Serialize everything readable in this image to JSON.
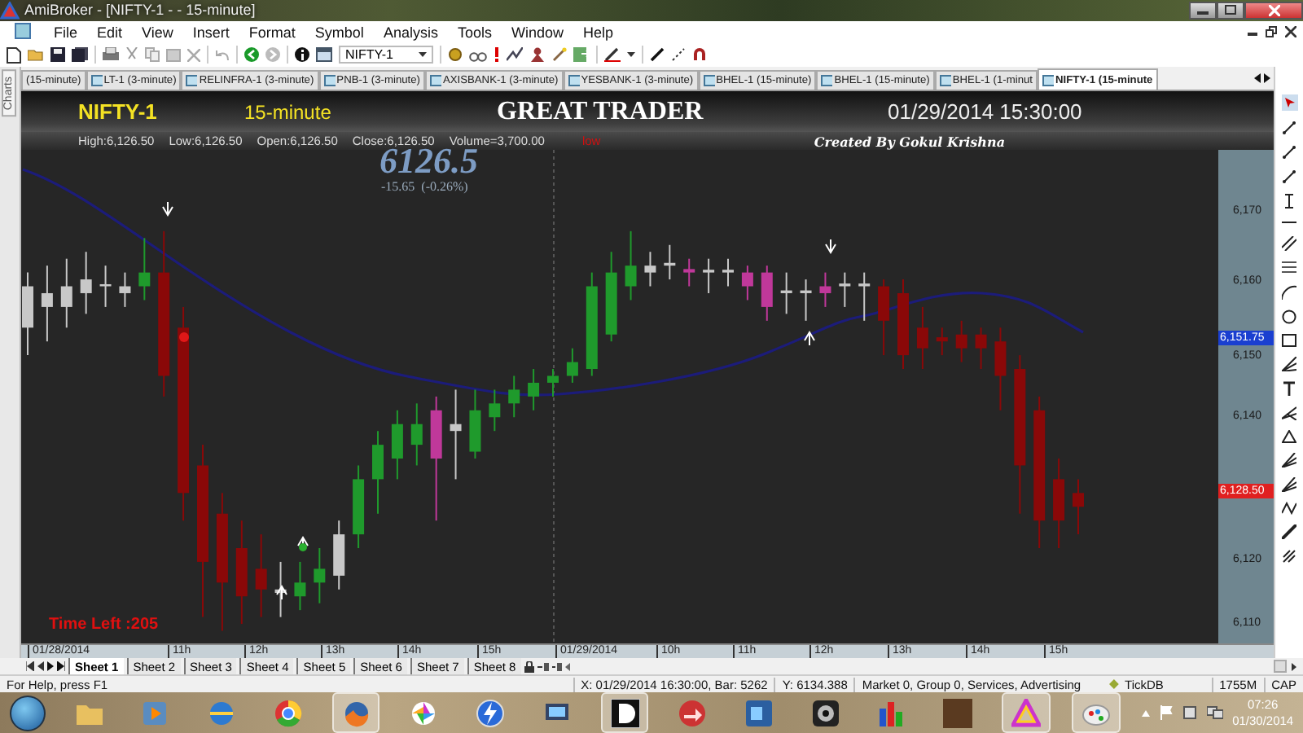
{
  "window": {
    "title": "AmiBroker - [NIFTY-1 - - 15-minute]"
  },
  "menu": [
    "File",
    "Edit",
    "View",
    "Insert",
    "Format",
    "Symbol",
    "Analysis",
    "Tools",
    "Window",
    "Help"
  ],
  "toolbar": {
    "symbol": "NIFTY-1"
  },
  "side_panel": {
    "label": "Charts"
  },
  "chart_tabs": [
    {
      "label": "(15-minute)",
      "selected": false
    },
    {
      "label": "LT-1 (3-minute)",
      "selected": false
    },
    {
      "label": "RELINFRA-1 (3-minute)",
      "selected": false
    },
    {
      "label": "PNB-1 (3-minute)",
      "selected": false
    },
    {
      "label": "AXISBANK-1 (3-minute)",
      "selected": false
    },
    {
      "label": "YESBANK-1 (3-minute)",
      "selected": false
    },
    {
      "label": "BHEL-1 (15-minute)",
      "selected": false
    },
    {
      "label": "BHEL-1 (15-minute)",
      "selected": false
    },
    {
      "label": "BHEL-1 (1-minut",
      "selected": false
    },
    {
      "label": "NIFTY-1 (15-minute",
      "selected": true
    }
  ],
  "chart": {
    "symbol": "NIFTY-1",
    "interval": "15-minute",
    "title": "GREAT TRADER",
    "datetime": "01/29/2014 15:30:00",
    "quote": [
      "High:6,126.50",
      "Low:6,126.50",
      "Open:6,126.50",
      "Close:6,126.50",
      "Volume=3,700.00"
    ],
    "signal": "low",
    "credit": "Created By Gokul Krishna",
    "last_price": "6126.5",
    "change": "-15.65  (-0.26%)",
    "time_left": "Time Left :205",
    "price_ticks": [
      "6,170",
      "6,160",
      "6,150",
      "6,140",
      "6,120",
      "6,110"
    ],
    "price_markers": [
      {
        "label": "6,151.75",
        "color": "#1a3fd0"
      },
      {
        "label": "6,128.50",
        "color": "#e02020"
      }
    ],
    "time_ticks": [
      "01/28/2014",
      "11h",
      "12h",
      "13h",
      "14h",
      "15h",
      "01/29/2014",
      "10h",
      "11h",
      "12h",
      "13h",
      "14h",
      "15h"
    ]
  },
  "sheets": [
    {
      "label": "Sheet 1",
      "selected": true
    },
    {
      "label": "Sheet 2",
      "selected": false
    },
    {
      "label": "Sheet 3",
      "selected": false
    },
    {
      "label": "Sheet 4",
      "selected": false
    },
    {
      "label": "Sheet 5",
      "selected": false
    },
    {
      "label": "Sheet 6",
      "selected": false
    },
    {
      "label": "Sheet 7",
      "selected": false
    },
    {
      "label": "Sheet 8",
      "selected": false
    }
  ],
  "status_bar": {
    "help": "For Help, press F1",
    "x": "X: 01/29/2014 16:30:00, Bar: 5262",
    "y": "Y: 6134.388",
    "info": "Market 0, Group 0, Services, Advertising",
    "db": "TickDB",
    "memory": "1755M",
    "caps": "CAP"
  },
  "taskbar": {
    "time": "07:26",
    "date": "01/30/2014"
  }
}
